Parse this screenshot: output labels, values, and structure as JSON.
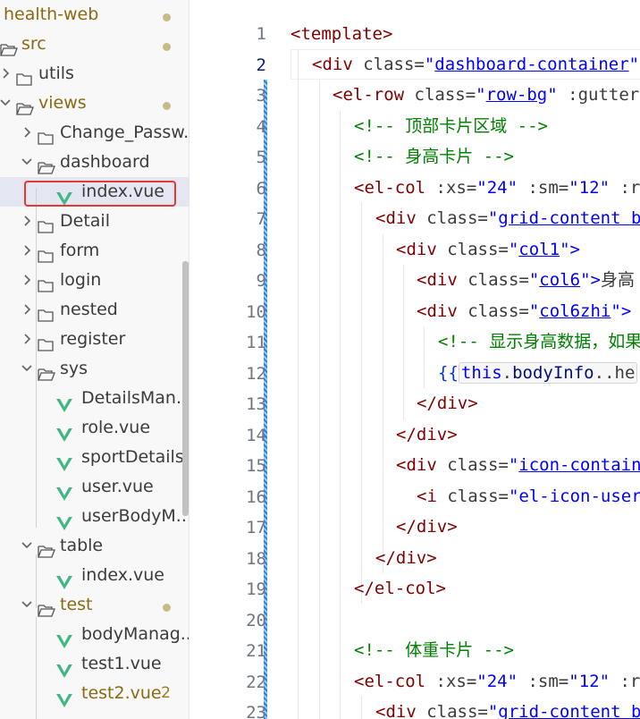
{
  "explorer": {
    "items": [
      {
        "label": "health-web",
        "kind": "root",
        "modified": true
      },
      {
        "label": "src",
        "kind": "folder-open",
        "modified": true
      },
      {
        "label": "utils",
        "kind": "folder-closed"
      },
      {
        "label": "views",
        "kind": "folder-open",
        "modified": true
      },
      {
        "label": "Change_Passw...",
        "kind": "folder-closed"
      },
      {
        "label": "dashboard",
        "kind": "folder-open"
      },
      {
        "label": "index.vue",
        "kind": "vue-file",
        "selected": true
      },
      {
        "label": "Detail",
        "kind": "folder-closed"
      },
      {
        "label": "form",
        "kind": "folder-closed"
      },
      {
        "label": "login",
        "kind": "folder-closed"
      },
      {
        "label": "nested",
        "kind": "folder-closed"
      },
      {
        "label": "register",
        "kind": "folder-closed"
      },
      {
        "label": "sys",
        "kind": "folder-open"
      },
      {
        "label": "DetailsMan...",
        "kind": "vue-file"
      },
      {
        "label": "role.vue",
        "kind": "vue-file"
      },
      {
        "label": "sportDetails...",
        "kind": "vue-file"
      },
      {
        "label": "user.vue",
        "kind": "vue-file"
      },
      {
        "label": "userBodyM...",
        "kind": "vue-file"
      },
      {
        "label": "table",
        "kind": "folder-open"
      },
      {
        "label": "index.vue",
        "kind": "vue-file"
      },
      {
        "label": "test",
        "kind": "folder-open",
        "modified": true
      },
      {
        "label": "bodyManag...",
        "kind": "vue-file"
      },
      {
        "label": "test1.vue",
        "kind": "vue-file"
      },
      {
        "label": "test2.vue",
        "kind": "vue-file",
        "badge": "2"
      }
    ]
  },
  "editor": {
    "line_numbers": [
      "1",
      "2",
      "3",
      "4",
      "5",
      "6",
      "7",
      "8",
      "9",
      "10",
      "11",
      "12",
      "13",
      "14",
      "15",
      "16",
      "17",
      "18",
      "19",
      "20",
      "21",
      "22",
      "23"
    ],
    "active_line": "2",
    "line1": {
      "t1": "<template>"
    },
    "line2": {
      "t1": "<div",
      "t2": " class=",
      "t3": "\"",
      "t4": "dashboard-container",
      "t5": "\""
    },
    "line3": {
      "t1": "<el-row",
      "t2": " class=",
      "t3": "\"",
      "t4": "row-bg",
      "t5": "\"",
      "t6": " :gutter"
    },
    "line4": {
      "t1": "<!-- 顶部卡片区域 -->"
    },
    "line5": {
      "t1": "<!-- 身高卡片 -->"
    },
    "line6": {
      "t1": "<el-col",
      "t2": " :xs=",
      "t3": "\"24\"",
      "t4": " :sm=",
      "t5": "\"12\"",
      "t6": " :r"
    },
    "line7": {
      "t1": "<div",
      "t2": " class=",
      "t3": "\"",
      "t4": "grid-content",
      "t5": " b"
    },
    "line8": {
      "t1": "<div",
      "t2": " class=",
      "t3": "\"",
      "t4": "col1",
      "t5": "\">"
    },
    "line9": {
      "t1": "<div",
      "t2": " class=",
      "t3": "\"",
      "t4": "col6",
      "t5": "\">",
      "t6": "身高"
    },
    "line10": {
      "t1": "<div",
      "t2": " class=",
      "t3": "\"",
      "t4": "col6zhi",
      "t5": "\">"
    },
    "line11": {
      "t1": "<!-- 显示身高数据，如果"
    },
    "line12": {
      "t1": "{{",
      "t2": "this",
      "t3": ".",
      "t4": "bodyInfo",
      "t5": ".he"
    },
    "line13": {
      "t1": "</div>"
    },
    "line14": {
      "t1": "</div>"
    },
    "line15": {
      "t1": "<div",
      "t2": " class=",
      "t3": "\"",
      "t4": "icon-contain"
    },
    "line16": {
      "t1": "<i",
      "t2": " class=",
      "t3": "\"el-icon-user"
    },
    "line17": {
      "t1": "</div>"
    },
    "line18": {
      "t1": "</div>"
    },
    "line19": {
      "t1": "</el-col>"
    },
    "line21": {
      "t1": "<!-- 体重卡片 -->"
    },
    "line22": {
      "t1": "<el-col",
      "t2": " :xs=",
      "t3": "\"24\"",
      "t4": " :sm=",
      "t5": "\"12\"",
      "t6": " :r"
    },
    "line23": {
      "t1": "<div",
      "t2": " class=",
      "t3": "\"",
      "t4": "grid-content",
      "t5": " b"
    }
  },
  "colors": {
    "tag": "#800000",
    "attr": "#e50000",
    "string": "#0000ff",
    "comment": "#008000",
    "vue_icon": "#41b883",
    "modified": "#8a6a13",
    "highlight": "#e53935"
  }
}
